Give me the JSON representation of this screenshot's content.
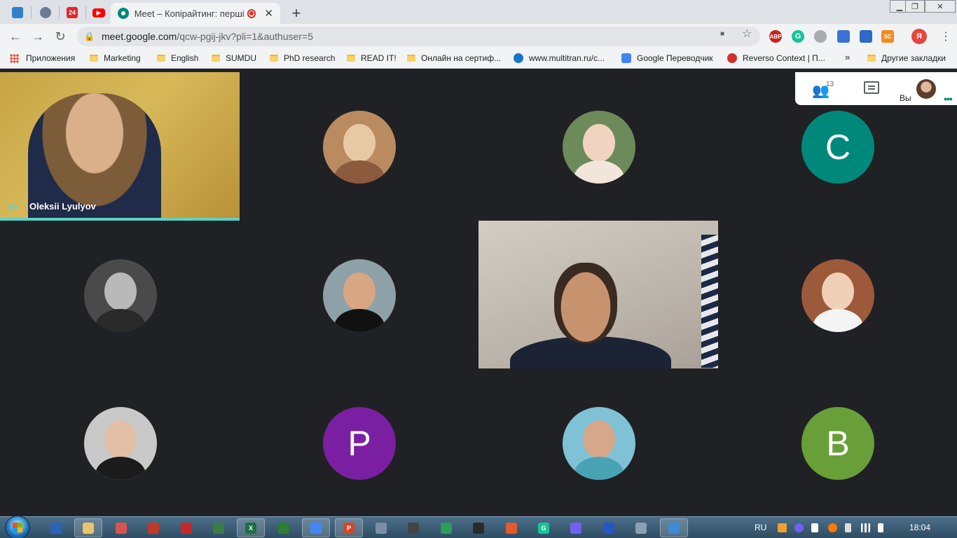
{
  "browser": {
    "tab": {
      "title": "Meet – Копірайтинг: перші",
      "close_glyph": "✕"
    },
    "pinned_tabs": [
      {
        "icon": "site-icon",
        "label": "",
        "color": "#2f80c9"
      },
      {
        "icon": "crest-icon",
        "label": "",
        "color": "#6b7b95"
      },
      {
        "icon": "news24-icon",
        "label": "24",
        "color": "#e4262b"
      },
      {
        "icon": "youtube-icon",
        "label": "▶",
        "color": "#ff0000"
      }
    ],
    "new_tab_glyph": "+",
    "window_controls": [
      "▁",
      "❐",
      "✕"
    ],
    "nav": {
      "back": "←",
      "forward": "→",
      "reload": "↻"
    },
    "url_host": "meet.google.com",
    "url_path": "/qcw-pgij-jkv?pli=1&authuser=5",
    "lock_glyph": "🔒",
    "omnibox_icons": {
      "camera": "■",
      "star": "☆"
    },
    "extensions": [
      {
        "icon": "adblock-icon",
        "label": "ABP",
        "color": "#c9221f"
      },
      {
        "icon": "grammarly-icon",
        "label": "G",
        "color": "#15c39a"
      },
      {
        "icon": "rainbow-icon",
        "label": "",
        "color": "#a9abb0"
      },
      {
        "icon": "screenshot-icon",
        "label": "",
        "color": "#3b73d6"
      },
      {
        "icon": "cap-icon",
        "label": "",
        "color": "#2f69c8"
      },
      {
        "icon": "sc-icon",
        "label": "SC",
        "color": "#f28b20"
      },
      {
        "icon": "yandex-icon",
        "label": "Я",
        "color": "#e8453c"
      }
    ],
    "menu_glyph": "⋮"
  },
  "bookmarks": {
    "apps_label": "Приложения",
    "items": [
      {
        "label": "Marketing",
        "type": "folder"
      },
      {
        "label": "English",
        "type": "folder"
      },
      {
        "label": "SUMDU",
        "type": "folder"
      },
      {
        "label": "PhD research",
        "type": "folder"
      },
      {
        "label": "READ IT!",
        "type": "folder"
      },
      {
        "label": "Онлайн на сертиф...",
        "type": "folder"
      },
      {
        "label": "www.multitran.ru/c...",
        "type": "site",
        "color": "#1a73c9"
      },
      {
        "label": "Google Переводчик",
        "type": "site",
        "color": "#4285f4"
      },
      {
        "label": "Reverso Context | П...",
        "type": "site",
        "color": "#d0312d"
      }
    ],
    "overflow_glyph": "»",
    "other_label": "Другие закладки"
  },
  "meet": {
    "speaker_name": "Oleksii Lyulyov",
    "participant_count": "13",
    "me_label": "Вы",
    "more_glyph": "•••",
    "people_glyph": "👥",
    "tiles": [
      {
        "kind": "photo",
        "face": "#e8c9a5",
        "shirt": "#8c5a3c",
        "bg": "#b98b5e"
      },
      {
        "kind": "photo",
        "face": "#f0d4c0",
        "shirt": "#f2e6da",
        "bg": "#6d8a5a"
      },
      {
        "kind": "letter",
        "letter": "C",
        "bg": "#00897b"
      },
      {
        "kind": "photo",
        "face": "#b9b9b9",
        "shirt": "#2a2a2a",
        "bg": "#4a4a4a"
      },
      {
        "kind": "photo",
        "face": "#d9a684",
        "shirt": "#111111",
        "bg": "#8fa1a8"
      },
      {
        "kind": "photo",
        "face": "#efcfb6",
        "shirt": "#f4f4f4",
        "bg": "#9c5a3a"
      },
      {
        "kind": "photo",
        "face": "#e2bfa6",
        "shirt": "#1b1b1b",
        "bg": "#c9c9c9"
      },
      {
        "kind": "letter",
        "letter": "P",
        "bg": "#7b1fa2"
      },
      {
        "kind": "photo",
        "face": "#d6a889",
        "shirt": "#4aa3b5",
        "bg": "#7fc2d6"
      },
      {
        "kind": "letter",
        "letter": "B",
        "bg": "#689f38"
      }
    ]
  },
  "taskbar": {
    "apps": [
      {
        "icon": "save-icon",
        "label": "",
        "color": "#2a64b8",
        "open": false
      },
      {
        "icon": "folder-icon",
        "label": "",
        "color": "#e9c46a",
        "open": true
      },
      {
        "icon": "paint-icon",
        "label": "",
        "color": "#d9534f",
        "open": false
      },
      {
        "icon": "book-icon",
        "label": "",
        "color": "#c0392b",
        "open": false
      },
      {
        "icon": "download-icon",
        "label": "",
        "color": "#c62828",
        "open": false
      },
      {
        "icon": "monitor-icon",
        "label": "",
        "color": "#3a7d44",
        "open": false
      },
      {
        "icon": "excel-icon",
        "label": "X",
        "color": "#1d6f42",
        "open": true
      },
      {
        "icon": "chart-app-icon",
        "label": "",
        "color": "#2e7d32",
        "open": false
      },
      {
        "icon": "chrome-icon",
        "label": "",
        "color": "#4285f4",
        "open": true
      },
      {
        "icon": "powerpoint-icon",
        "label": "P",
        "color": "#d24726",
        "open": true
      },
      {
        "icon": "palette-icon",
        "label": "",
        "color": "#7a8fa6",
        "open": false
      },
      {
        "icon": "edit-app-icon",
        "label": "",
        "color": "#444444",
        "open": false
      },
      {
        "icon": "tree-icon",
        "label": "",
        "color": "#2e9d57",
        "open": false
      },
      {
        "icon": "font-app-icon",
        "label": "",
        "color": "#2b2b2b",
        "open": false
      },
      {
        "icon": "pen-app-icon",
        "label": "",
        "color": "#e25b2b",
        "open": false
      },
      {
        "icon": "grammarly-app-icon",
        "label": "G",
        "color": "#15c39a",
        "open": false
      },
      {
        "icon": "viber-icon",
        "label": "",
        "color": "#7360f2",
        "open": false
      },
      {
        "icon": "feather-icon",
        "label": "",
        "color": "#2855c4",
        "open": false
      },
      {
        "icon": "palette2-icon",
        "label": "",
        "color": "#8aa0b5",
        "open": false
      },
      {
        "icon": "image-viewer-icon",
        "label": "",
        "color": "#3d8ad6",
        "open": true
      }
    ],
    "lang": "RU",
    "clock": "18:04",
    "tray": [
      {
        "icon": "tray-orange-icon",
        "color": "#f0a030"
      },
      {
        "icon": "tray-viber-icon",
        "color": "#7360f2"
      },
      {
        "icon": "tray-flag-icon",
        "color": "#ffffff"
      },
      {
        "icon": "tray-avast-icon",
        "color": "#ff7800"
      },
      {
        "icon": "tray-device-icon",
        "color": "#dddddd"
      },
      {
        "icon": "tray-network-icon",
        "color": "#ffffff"
      },
      {
        "icon": "tray-volume-icon",
        "color": "#ffffff"
      }
    ]
  }
}
